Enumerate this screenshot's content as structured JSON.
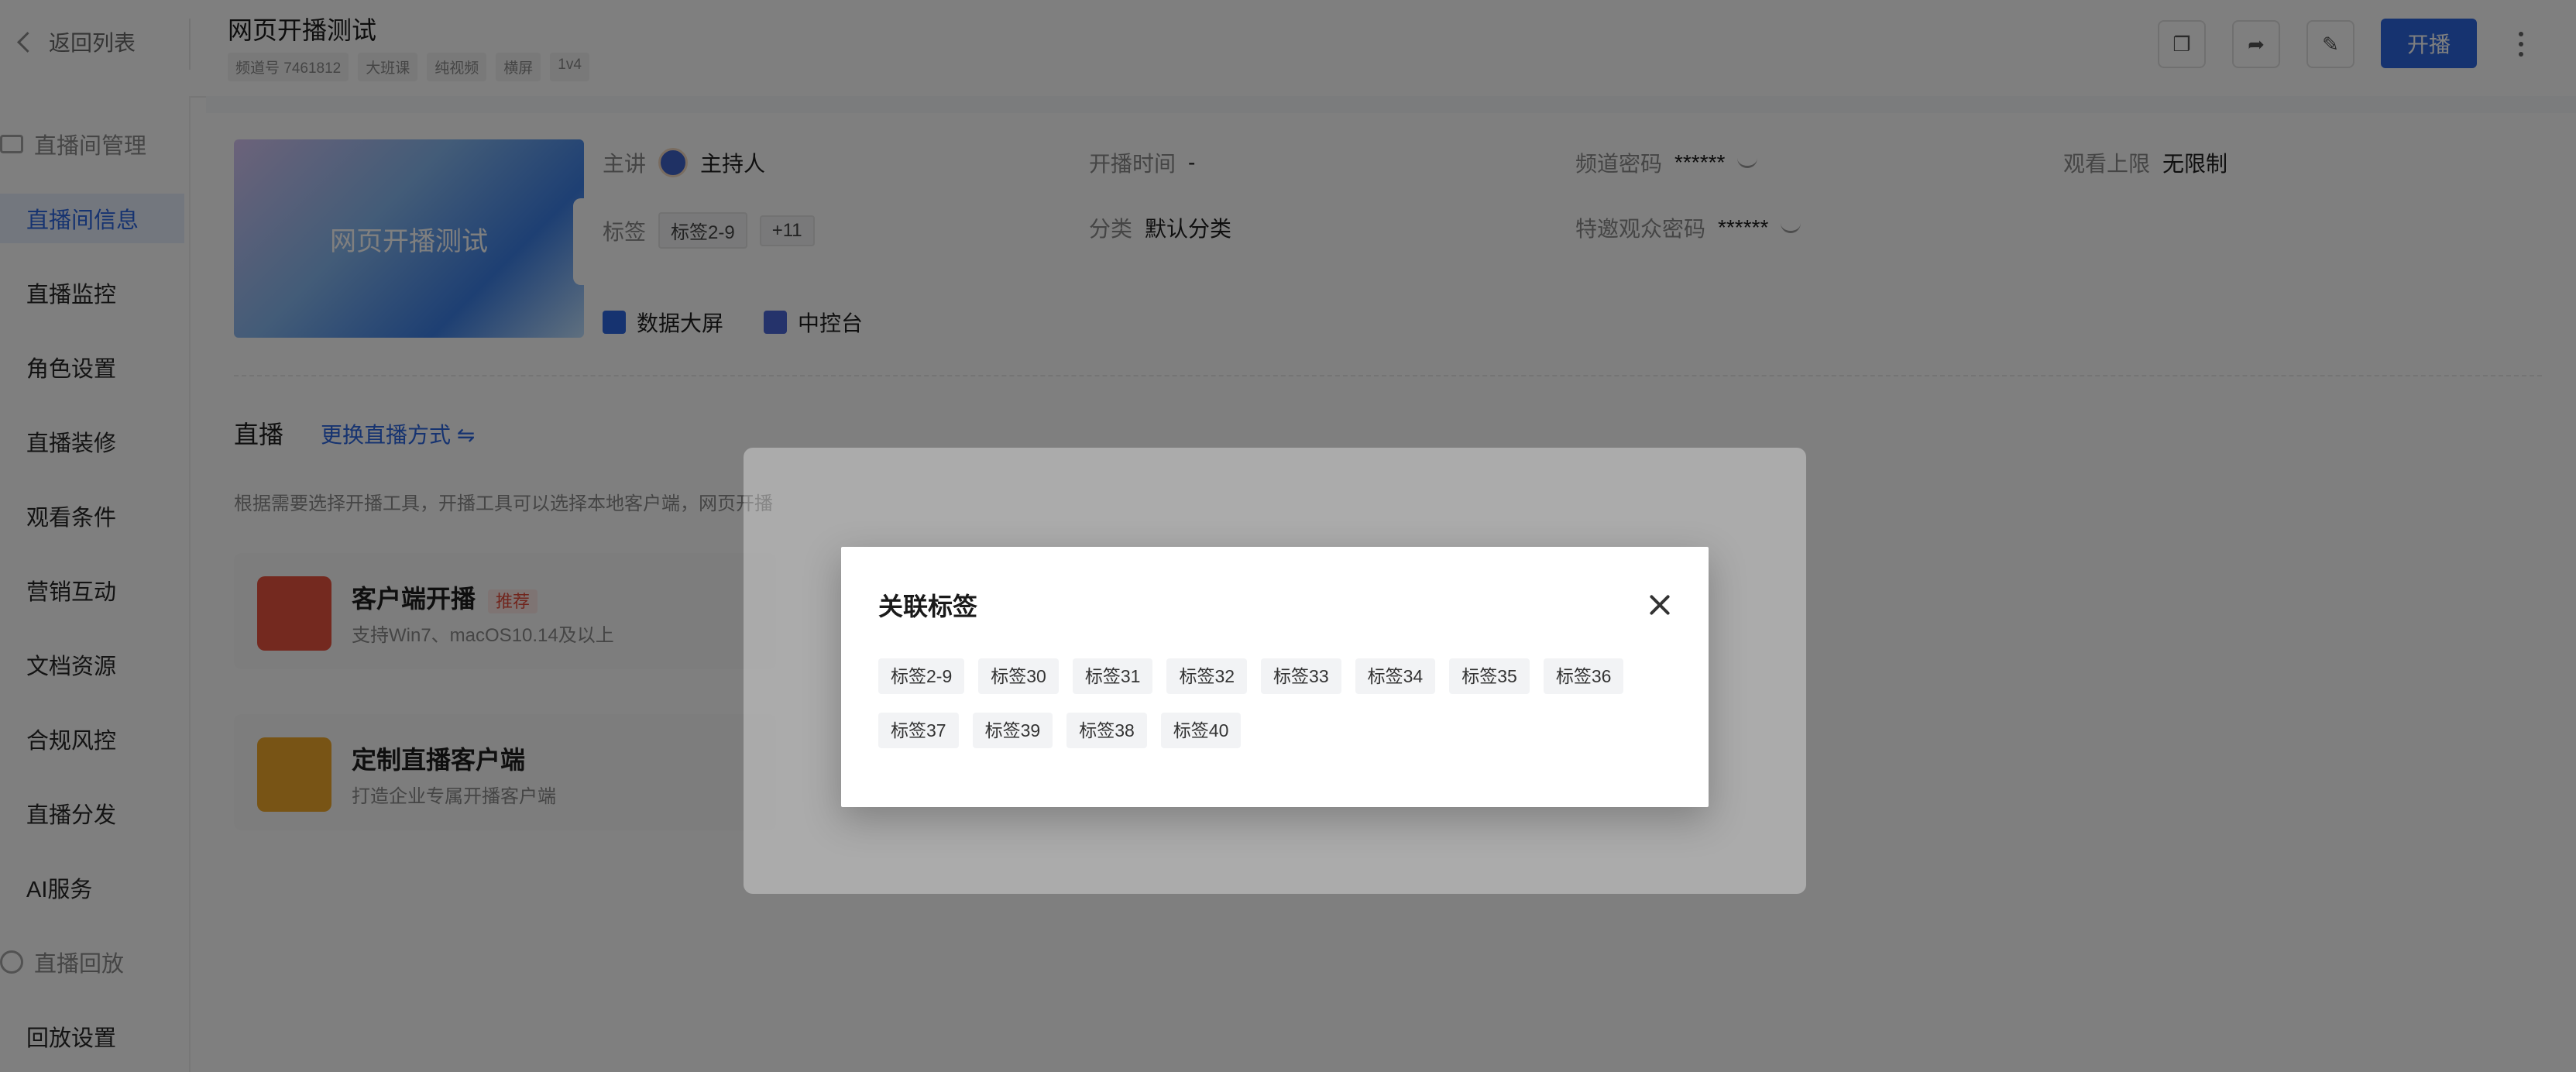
{
  "header": {
    "back_label": "返回列表",
    "title": "网页开播测试",
    "chips": [
      "频道号 7461812",
      "大班课",
      "纯视频",
      "横屏",
      "1v4"
    ],
    "primary_button": "开播"
  },
  "sidebar": {
    "group1": "直播间管理",
    "items": [
      "直播间信息",
      "直播监控",
      "角色设置",
      "直播装修",
      "观看条件",
      "营销互动",
      "文档资源",
      "合规风控",
      "直播分发",
      "AI服务"
    ],
    "group2": "直播回放",
    "items2": [
      "回放设置"
    ]
  },
  "info": {
    "cover_text": "网页开播测试",
    "host_label": "主讲",
    "host_value": "主持人",
    "start_label": "开播时间",
    "start_value": "-",
    "pwd_label": "频道密码",
    "pwd_value": "******",
    "limit_label": "观看上限",
    "limit_value": "无限制",
    "tags_label": "标签",
    "tag_first": "标签2-9",
    "tag_more": "+11",
    "cat_label": "分类",
    "cat_value": "默认分类",
    "vip_pwd_label": "特邀观众密码",
    "vip_pwd_value": "******",
    "tool1": "数据大屏",
    "tool2": "中控台"
  },
  "live": {
    "title": "直播",
    "switch_link": "更换直播方式 ⇋",
    "desc": "根据需要选择开播工具，开播工具可以选择本地客户端，网页开播",
    "opt1_title": "客户端开播",
    "opt1_badge": "推荐",
    "opt1_sub": "支持Win7、macOS10.14及以上",
    "opt2_title": "定制直播客户端",
    "opt2_sub": "打造企业专属开播客户端"
  },
  "modal": {
    "title": "关联标签",
    "tags": [
      "标签2-9",
      "标签30",
      "标签31",
      "标签32",
      "标签33",
      "标签34",
      "标签35",
      "标签36",
      "标签37",
      "标签39",
      "标签38",
      "标签40"
    ]
  }
}
